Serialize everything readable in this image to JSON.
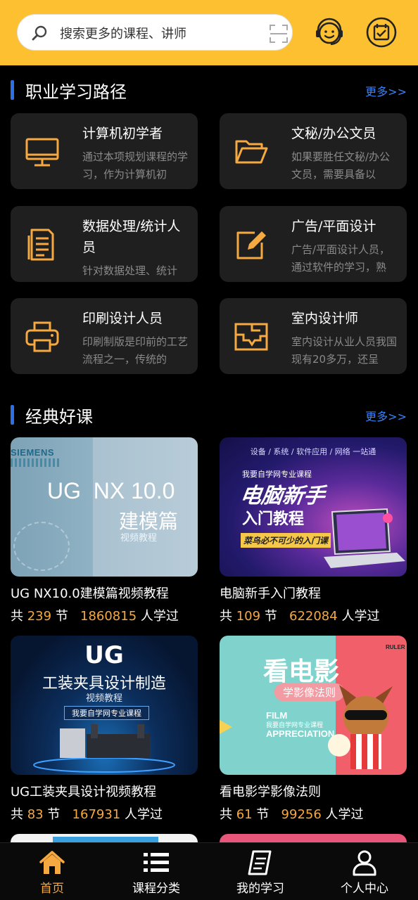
{
  "colors": {
    "accent": "#fcc030",
    "icon_orange": "#f5a940",
    "link_blue": "#3b82f6"
  },
  "search": {
    "placeholder": "搜索更多的课程、讲师",
    "icon": "search-icon",
    "scan_icon": "scan-icon"
  },
  "header_icons": [
    "customer-service-icon",
    "calendar-check-icon"
  ],
  "career": {
    "title": "职业学习路径",
    "more": "更多>>",
    "items": [
      {
        "title": "计算机初学者",
        "desc": "通过本项规划课程的学习，作为计算机初",
        "icon": "monitor-icon"
      },
      {
        "title": "文秘/办公文员",
        "desc": "如果要胜任文秘/办公文员，需要具备以",
        "icon": "folder-icon"
      },
      {
        "title": "数据处理/统计人员",
        "desc": "针对数据处理、统计",
        "icon": "document-icon"
      },
      {
        "title": "广告/平面设计",
        "desc": "广告/平面设计人员，通过软件的学习，熟",
        "icon": "edit-icon"
      },
      {
        "title": "印刷设计人员",
        "desc": "印刷制版是印前的工艺流程之一，传统的",
        "icon": "printer-icon"
      },
      {
        "title": "室内设计师",
        "desc": "室内设计从业人员我国现有20多万，还呈",
        "icon": "floorplan-icon"
      }
    ]
  },
  "classic": {
    "title": "经典好课",
    "more": "更多>>",
    "prefix": "共",
    "unit": "节",
    "suffix": "人学过",
    "courses": [
      {
        "title": "UG NX10.0建模篇视频教程",
        "lessons": "239",
        "learners": "1860815",
        "thumb": {
          "brand": "SIEMENS",
          "big": "UG  NX 10.0",
          "sub": "建模篇",
          "small": "视频教程"
        }
      },
      {
        "title": "电脑新手入门教程",
        "lessons": "109",
        "learners": "622084",
        "thumb": {
          "top": "设备 / 系统 / 软件应用 / 网络 一站通",
          "tag": "我要自学网专业课程",
          "big": "电脑新手",
          "sub": "入门教程",
          "small": "菜鸟必不可少的入门课"
        }
      },
      {
        "title": "UG工装夹具设计视频教程",
        "lessons": "83",
        "learners": "167931",
        "thumb": {
          "big": "UG",
          "sub": "工装夹具设计制造",
          "small": "视频教程",
          "tag": "我要自学网专业课程"
        }
      },
      {
        "title": "看电影学影像法则",
        "lessons": "61",
        "learners": "99256",
        "thumb": {
          "brand": "RULER",
          "big": "看电影",
          "sub": "学影像法则",
          "small": "我要自学网专业课程",
          "en1": "FILM",
          "en2": "APPRECIATION"
        }
      }
    ]
  },
  "tabs": [
    {
      "label": "首页",
      "icon": "home-icon",
      "active": true
    },
    {
      "label": "课程分类",
      "icon": "category-list-icon"
    },
    {
      "label": "我的学习",
      "icon": "notebook-icon"
    },
    {
      "label": "个人中心",
      "icon": "user-icon"
    }
  ]
}
